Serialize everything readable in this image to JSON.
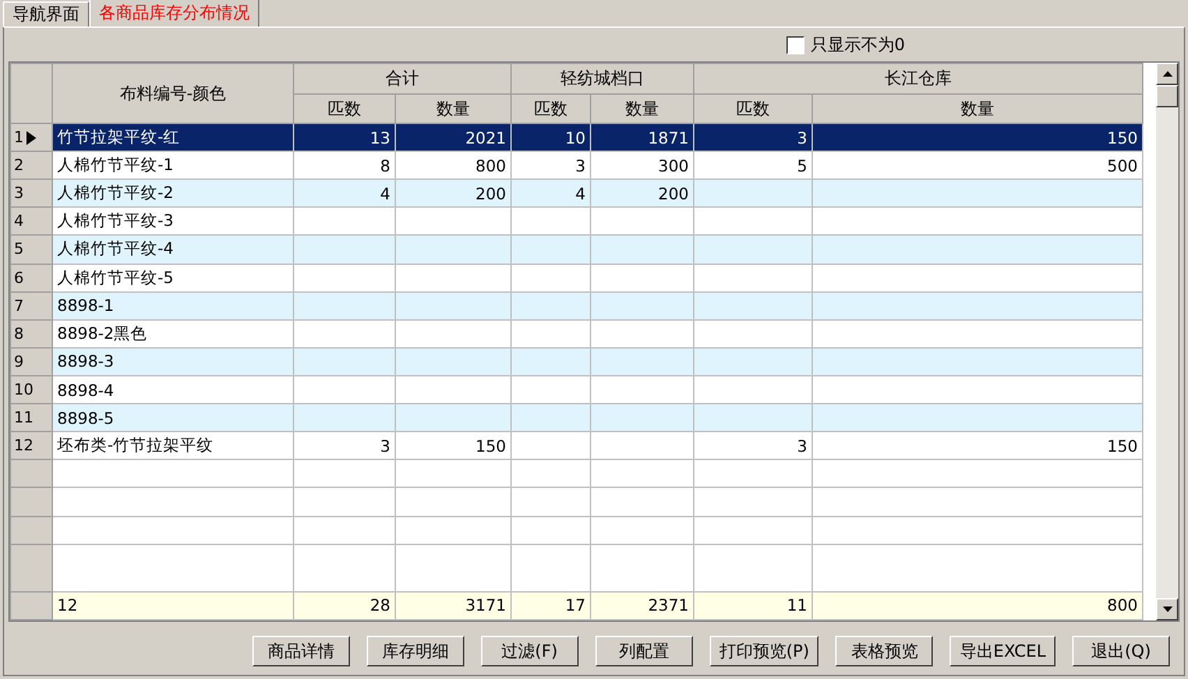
{
  "tabs": [
    {
      "label": "导航界面",
      "selected": false
    },
    {
      "label": "各商品库存分布情况",
      "selected": true
    }
  ],
  "filter": {
    "label": "只显示不为0",
    "checked": false
  },
  "table": {
    "name_column": "布料编号-颜色",
    "groups": [
      {
        "label": "合计",
        "columns": [
          "匹数",
          "数量"
        ]
      },
      {
        "label": "轻纺城档口",
        "columns": [
          "匹数",
          "数量"
        ]
      },
      {
        "label": "长江仓库",
        "columns": [
          "匹数",
          "数量"
        ]
      }
    ],
    "rows": [
      {
        "number": "1",
        "name": "竹节拉架平纹-红",
        "total": {
          "pieces": "13",
          "quantity": "2021"
        },
        "shop": {
          "pieces": "10",
          "quantity": "1871"
        },
        "warehouse": {
          "pieces": "3",
          "quantity": "150"
        },
        "selected": true
      },
      {
        "number": "2",
        "name": "人棉竹节平纹-1",
        "total": {
          "pieces": "8",
          "quantity": "800"
        },
        "shop": {
          "pieces": "3",
          "quantity": "300"
        },
        "warehouse": {
          "pieces": "5",
          "quantity": "500"
        },
        "selected": false
      },
      {
        "number": "3",
        "name": "人棉竹节平纹-2",
        "total": {
          "pieces": "4",
          "quantity": "200"
        },
        "shop": {
          "pieces": "4",
          "quantity": "200"
        },
        "selected": false
      },
      {
        "number": "4",
        "name": "人棉竹节平纹-3",
        "selected": false
      },
      {
        "number": "5",
        "name": "人棉竹节平纹-4",
        "selected": false
      },
      {
        "number": "6",
        "name": "人棉竹节平纹-5",
        "selected": false
      },
      {
        "number": "7",
        "name": "8898-1",
        "selected": false
      },
      {
        "number": "8",
        "name": "8898-2黑色",
        "selected": false
      },
      {
        "number": "9",
        "name": "8898-3",
        "selected": false
      },
      {
        "number": "10",
        "name": "8898-4",
        "selected": false
      },
      {
        "number": "11",
        "name": "8898-5",
        "selected": false
      },
      {
        "number": "12",
        "name": "坯布类-竹节拉架平纹",
        "total": {
          "pieces": "3",
          "quantity": "150"
        },
        "warehouse": {
          "pieces": "3",
          "quantity": "150"
        },
        "selected": false
      }
    ],
    "footer": {
      "count": "12",
      "values": [
        "28",
        "3171",
        "17",
        "2371",
        "11",
        "800"
      ]
    }
  },
  "buttons": [
    "商品详情",
    "库存明细",
    "过滤(F)",
    "列配置",
    "打印预览(P)",
    "表格预览",
    "导出EXCEL",
    "退出(Q)"
  ]
}
